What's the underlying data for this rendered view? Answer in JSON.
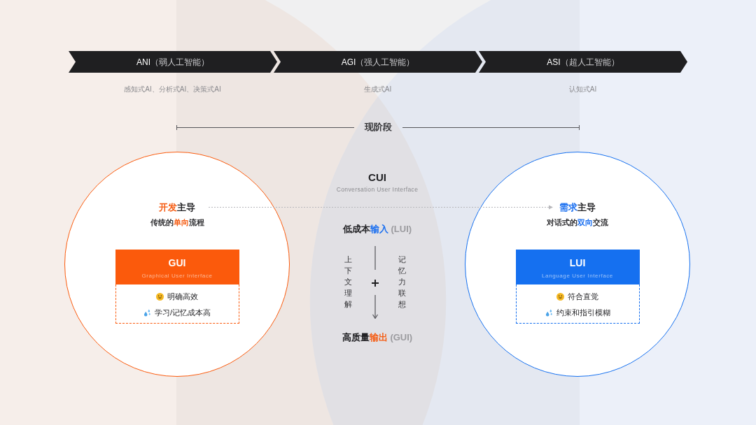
{
  "stages": [
    {
      "code": "ANI",
      "name": "（弱人工智能）",
      "example": "感知式AI、分析式AI、决策式AI"
    },
    {
      "code": "AGI",
      "name": "（强人工智能）",
      "example": "生成式AI"
    },
    {
      "code": "ASI",
      "name": "（超人工智能）",
      "example": "认知式AI"
    }
  ],
  "current_stage": {
    "label": "现阶段"
  },
  "columns": [
    {
      "kind": "panel",
      "color": "#fb5a0c",
      "title": [
        {
          "text": "开发",
          "color": "#f55d14"
        },
        {
          "text": "主导"
        }
      ],
      "subtitle": [
        {
          "text": "传统的"
        },
        {
          "text": "单向",
          "color": "#f55d14"
        },
        {
          "text": "流程"
        }
      ],
      "card": {
        "title": "GUI",
        "subtitle": "Graphical User Interface",
        "features": [
          {
            "kind": "pro",
            "text": "明确高效"
          },
          {
            "kind": "con",
            "text": "学习/记忆成本高"
          }
        ]
      }
    },
    {
      "kind": "flow",
      "title": "CUI",
      "subtitle": "Conversation User Interface",
      "input": [
        {
          "text": "低成本"
        },
        {
          "text": "输入",
          "color": "#1a6ff0"
        },
        {
          "text": " (LUI)",
          "color": "#9b9b9f"
        }
      ],
      "left_column": "上下文理解",
      "right_column": "记忆力联想",
      "output": [
        {
          "text": "高质量"
        },
        {
          "text": "输出",
          "color": "#f55d14"
        },
        {
          "text": " (GUI)",
          "color": "#9b9b9f"
        }
      ]
    },
    {
      "kind": "panel",
      "color": "#1570f0",
      "title": [
        {
          "text": "需求",
          "color": "#1a6ff0"
        },
        {
          "text": "主导"
        }
      ],
      "subtitle": [
        {
          "text": "对话式的"
        },
        {
          "text": "双向",
          "color": "#1a6ff0"
        },
        {
          "text": "交流"
        }
      ],
      "card": {
        "title": "LUI",
        "subtitle": "Language User Interface",
        "features": [
          {
            "kind": "pro",
            "text": "符合直觉"
          },
          {
            "kind": "con",
            "text": "约束和指引模糊"
          }
        ]
      }
    }
  ]
}
